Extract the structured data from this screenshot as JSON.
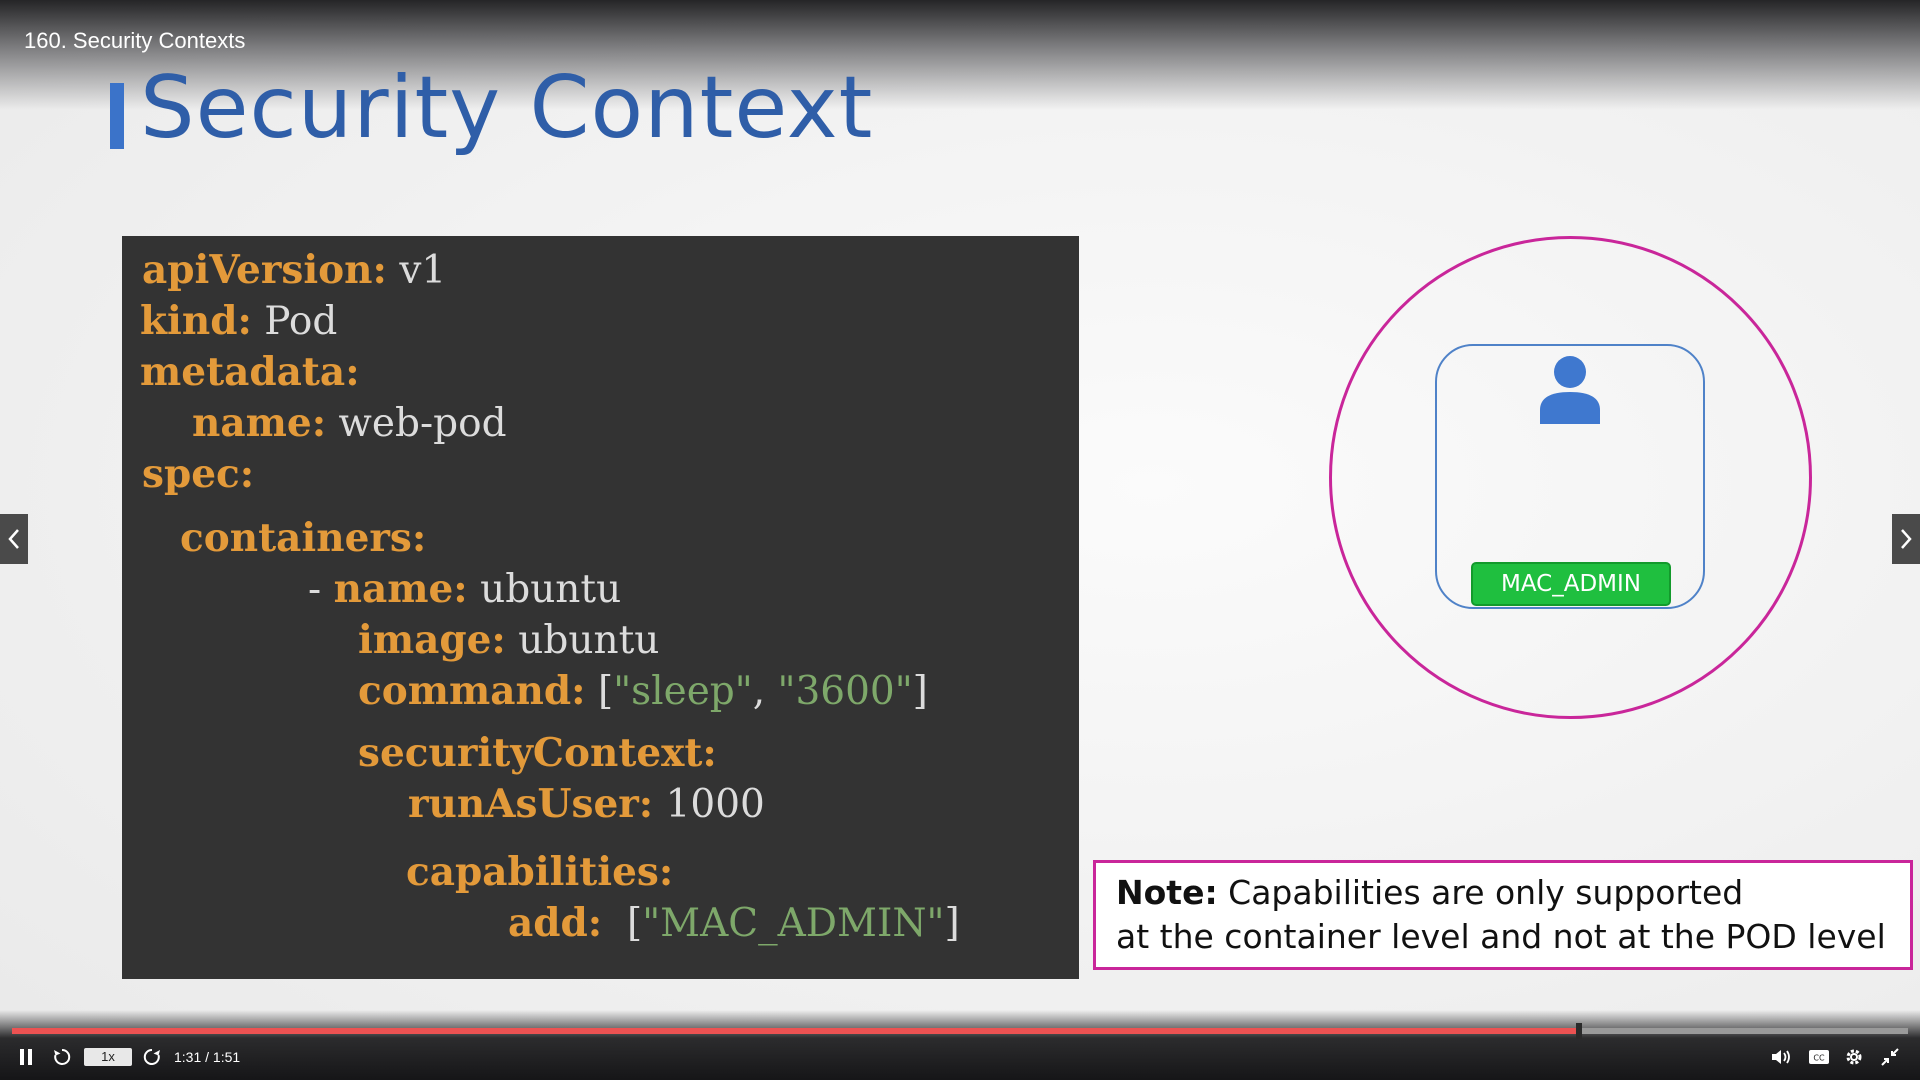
{
  "player": {
    "video_title": "160. Security Contexts",
    "speed_label": "1x",
    "time_label": "1:31 / 1:51",
    "progress": 0.825,
    "icons": {
      "play_pause": "pause-icon",
      "rewind": "rewind-icon",
      "forward": "forward-icon",
      "volume": "volume-icon",
      "captions": "captions-icon",
      "settings": "gear-icon",
      "fullscreen": "exit-fullscreen-icon",
      "prev": "chevron-left-icon",
      "next": "chevron-right-icon"
    }
  },
  "slide": {
    "title": "Security Context",
    "code": {
      "line1_key": "apiVersion:",
      "line1_val": "v1",
      "line2_key": "kind:",
      "line2_val": "Pod",
      "line3_key": "metadata:",
      "line4_key": "name:",
      "line4_val": "web-pod",
      "line5_key": "spec:",
      "line6_key": "containers:",
      "line7_dash": "-",
      "line7_key": "name:",
      "line7_val": "ubuntu",
      "line8_key": "image:",
      "line8_val": "ubuntu",
      "line9_key": "command:",
      "line9_b1": "[",
      "line9_s1": "\"sleep\"",
      "line9_comma": ",",
      "line9_s2": "\"3600\"",
      "line9_b2": "]",
      "line10_key": "securityContext:",
      "line11_key": "runAsUser:",
      "line11_val": "1000",
      "line12_key": "capabilities:",
      "line13_key": "add:",
      "line13_b1": "[",
      "line13_s1": "\"MAC_ADMIN\"",
      "line13_b2": "]"
    },
    "diagram": {
      "capability_badge": "MAC_ADMIN"
    },
    "note": {
      "label": "Note:",
      "text_line1": "Capabilities are only supported",
      "text_line2": "at the container level and not at the POD level"
    }
  },
  "colors": {
    "title": "#2f5ea8",
    "code_bg": "#333333",
    "code_key": "#e39a3a",
    "code_string": "#7ea86a",
    "pod_border": "#c9269a",
    "container_border": "#4f82c8",
    "badge": "#1fbf3f",
    "progress": "#ec5252"
  }
}
